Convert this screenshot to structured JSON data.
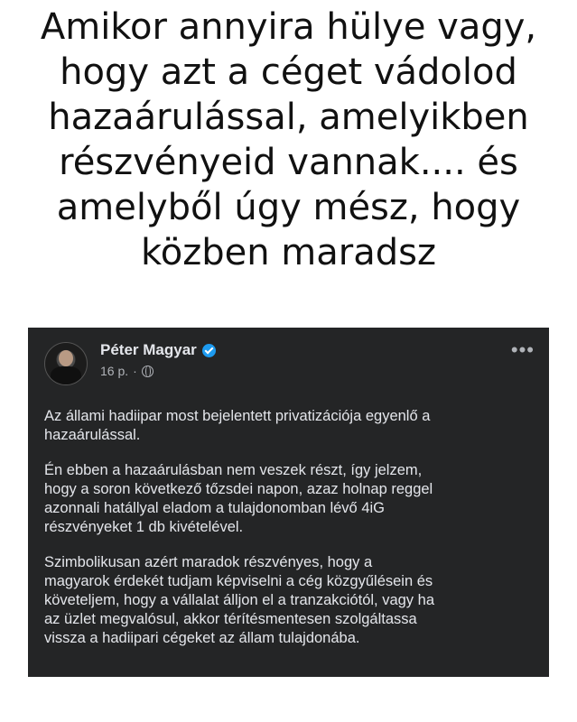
{
  "meme": {
    "caption_lines": [
      "Amikor annyira hülye vagy,",
      "hogy azt a céget vádolod",
      "hazaárulással, amelyikben",
      "részvényeid vannak.... és",
      "amelyből úgy mész, hogy",
      "közben maradsz"
    ]
  },
  "post": {
    "author_name": "Péter Magyar",
    "timestamp": "16 p.",
    "separator": "·",
    "audience_icon": "globe-icon",
    "verified_icon": "verified-badge-icon",
    "more_label": "•••",
    "paragraphs": [
      [
        "Az állami hadiipar most bejelentett privatizációja egyenlő a",
        "hazaárulással."
      ],
      [
        "Én ebben a hazaárulásban nem veszek részt, így jelzem,",
        "hogy a soron következő tőzsdei napon, azaz holnap reggel",
        "azonnali hatállyal eladom a tulajdonomban lévő 4iG",
        "részvényeket 1 db kivételével."
      ],
      [
        "Szimbolikusan azért maradok részvényes, hogy a",
        "magyarok érdekét tudjam képviselni a cég közgyűlésein és",
        "követeljem, hogy a vállalat álljon el a tranzakciótól, vagy ha",
        "az üzlet megvalósul, akkor térítésmentesen szolgáltassa",
        "vissza a hadiipari cégeket az állam tulajdonába."
      ]
    ]
  },
  "colors": {
    "post_background": "#242526",
    "post_text": "#e4e6eb",
    "secondary_text": "#b0b3b8",
    "verified_badge": "#1d9bf0"
  }
}
